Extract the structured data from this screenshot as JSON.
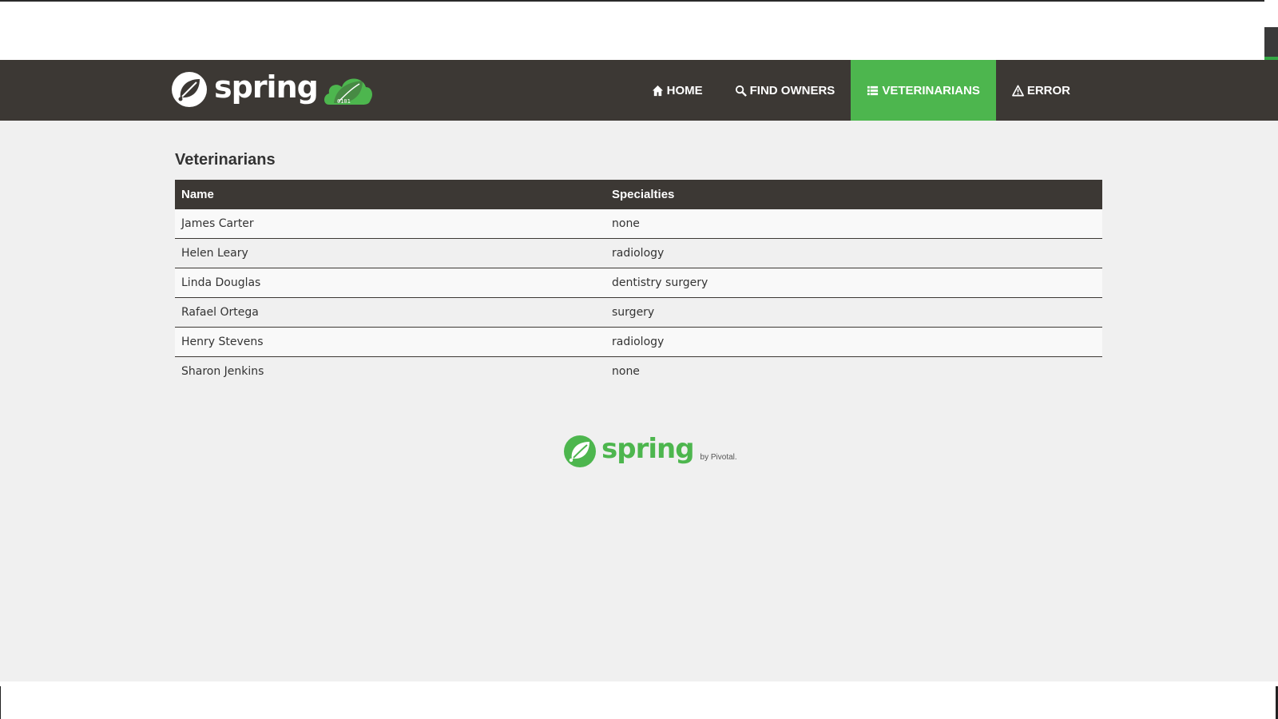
{
  "brand": {
    "name": "spring",
    "cloud_text": "0101"
  },
  "nav": {
    "items": [
      {
        "label": "HOME",
        "icon": "home-icon",
        "active": false
      },
      {
        "label": "FIND OWNERS",
        "icon": "search-icon",
        "active": false
      },
      {
        "label": "VETERINARIANS",
        "icon": "list-icon",
        "active": true
      },
      {
        "label": "ERROR",
        "icon": "warning-icon",
        "active": false
      }
    ]
  },
  "page": {
    "title": "Veterinarians"
  },
  "table": {
    "headers": [
      "Name",
      "Specialties"
    ],
    "rows": [
      [
        "James Carter",
        "none"
      ],
      [
        "Helen Leary",
        "radiology"
      ],
      [
        "Linda Douglas",
        "dentistry surgery"
      ],
      [
        "Rafael Ortega",
        "surgery"
      ],
      [
        "Henry Stevens",
        "radiology"
      ],
      [
        "Sharon Jenkins",
        "none"
      ]
    ]
  },
  "footer": {
    "logo_text": "spring",
    "by_text": "by Pivotal."
  },
  "colors": {
    "navbar": "#3c3834",
    "accent": "#4db64e",
    "content_bg": "#f0f0f0"
  }
}
